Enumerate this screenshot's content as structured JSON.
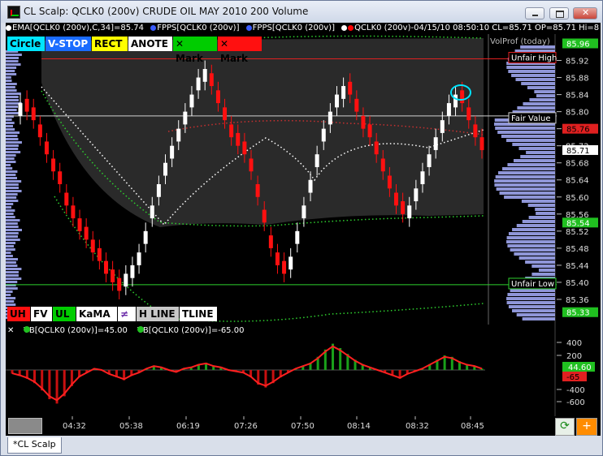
{
  "window": {
    "title": "CL Scalp: QCLK0 (200v) CRUDE OIL MAY 2010 200 Volume"
  },
  "infobar": {
    "ema": "EMA[QCLK0 (200v),C,34]=85.74",
    "fpps1": "FPPS[QCLK0 (200v)]",
    "fpps2": "FPPS[QCLK0 (200v)]",
    "quote": "QCLK0 (200v)-04/15/10 08:50:10 CL=85.71 OP=85.71 Hi=8"
  },
  "toolbar_top": [
    {
      "label": "Circle",
      "bg": "#00e5ff",
      "fg": "#000"
    },
    {
      "label": "V-STOP",
      "bg": "#1a6cff",
      "fg": "#fff"
    },
    {
      "label": "RECT",
      "bg": "#ffff00",
      "fg": "#000"
    },
    {
      "label": "ANOTE",
      "bg": "#ffffff",
      "fg": "#000"
    },
    {
      "label": "✕ Mark",
      "bg": "#00cc00",
      "fg": "#000"
    },
    {
      "label": "✕ Mark",
      "bg": "#ff1010",
      "fg": "#000"
    }
  ],
  "toolbar_bottom": [
    {
      "label": "UH",
      "bg": "#ff1010",
      "fg": "#000"
    },
    {
      "label": "FV",
      "bg": "#ffffff",
      "fg": "#000"
    },
    {
      "label": "UL",
      "bg": "#00cc00",
      "fg": "#000"
    },
    {
      "label": "KaMA",
      "bg": "#ffffff",
      "fg": "#000"
    },
    {
      "label": "≠",
      "bg": "#ffffff",
      "fg": "#6a2aa8"
    },
    {
      "label": "H LINE",
      "bg": "#c8c8c8",
      "fg": "#000"
    },
    {
      "label": "TLINE",
      "bg": "#ffffff",
      "fg": "#000"
    }
  ],
  "volprof_title": "VolProf (today)",
  "price_ticks": [
    "85.92",
    "85.88",
    "85.84",
    "85.80",
    "85.76",
    "85.72",
    "85.68",
    "85.64",
    "85.60",
    "85.56",
    "85.52",
    "85.48",
    "85.44",
    "85.40",
    "85.36"
  ],
  "price_badges": {
    "top": "85.96",
    "red": "85.76",
    "current": "85.71",
    "green_mid": "85.54",
    "green_low": "85.33"
  },
  "annotations": {
    "unfair_high": "Unfair High",
    "fair_value": "Fair Value",
    "unfair_low": "Unfair Low"
  },
  "lower_pane": {
    "legend1": "VB[QCLK0 (200v)]=45.00",
    "legend2": "VB[QCLK0 (200v)]=-65.00",
    "ticks": [
      "400",
      "200",
      "-400",
      "-600"
    ],
    "badge_green": "44.60",
    "badge_red": "-65"
  },
  "time_ticks": [
    "04:32",
    "05:38",
    "06:19",
    "07:26",
    "07:50",
    "08:14",
    "08:32",
    "08:45"
  ],
  "tabs": {
    "active": "*CL Scalp"
  },
  "colors": {
    "up": "#ffffff",
    "down": "#ff1010",
    "fair": "#e0e0e0"
  }
}
